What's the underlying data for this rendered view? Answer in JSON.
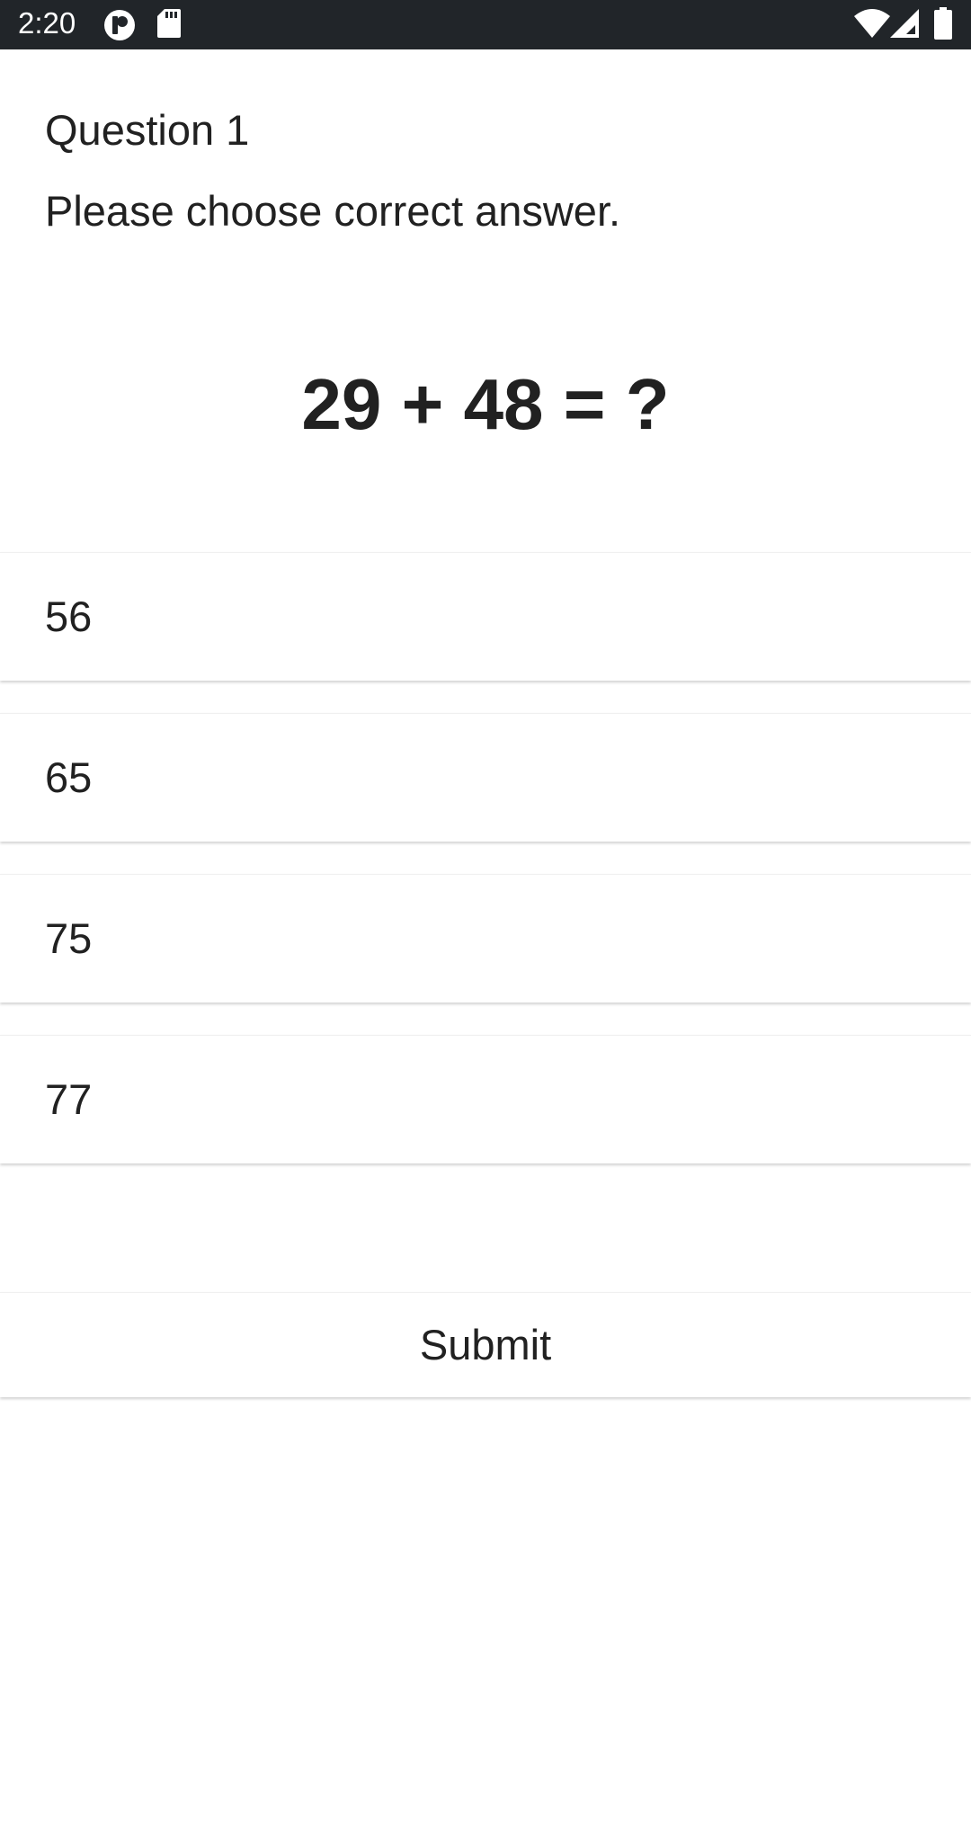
{
  "status_bar": {
    "time": "2:20",
    "icons": [
      "app-notification-icon",
      "sd-card-icon",
      "wifi-icon",
      "cell-signal-icon",
      "battery-icon"
    ]
  },
  "question": {
    "title": "Question 1",
    "instruction": "Please choose correct answer.",
    "equation": "29 + 48 = ?"
  },
  "options": [
    {
      "label": "56"
    },
    {
      "label": "65"
    },
    {
      "label": "75"
    },
    {
      "label": "77"
    }
  ],
  "submit_label": "Submit",
  "colors": {
    "status_bar_bg": "#212529",
    "background": "#ffffff",
    "text": "#212121"
  }
}
